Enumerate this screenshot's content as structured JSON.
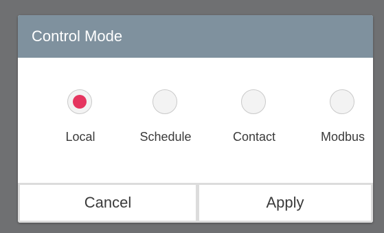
{
  "dialog": {
    "title": "Control Mode",
    "options": [
      {
        "label": "Local",
        "selected": true
      },
      {
        "label": "Schedule",
        "selected": false
      },
      {
        "label": "Contact",
        "selected": false
      },
      {
        "label": "Modbus",
        "selected": false
      }
    ],
    "buttons": {
      "cancel_label": "Cancel",
      "apply_label": "Apply"
    }
  },
  "colors": {
    "header": "#7f919e",
    "selected_dot": "#e5355f",
    "backdrop": "#6f7072"
  }
}
